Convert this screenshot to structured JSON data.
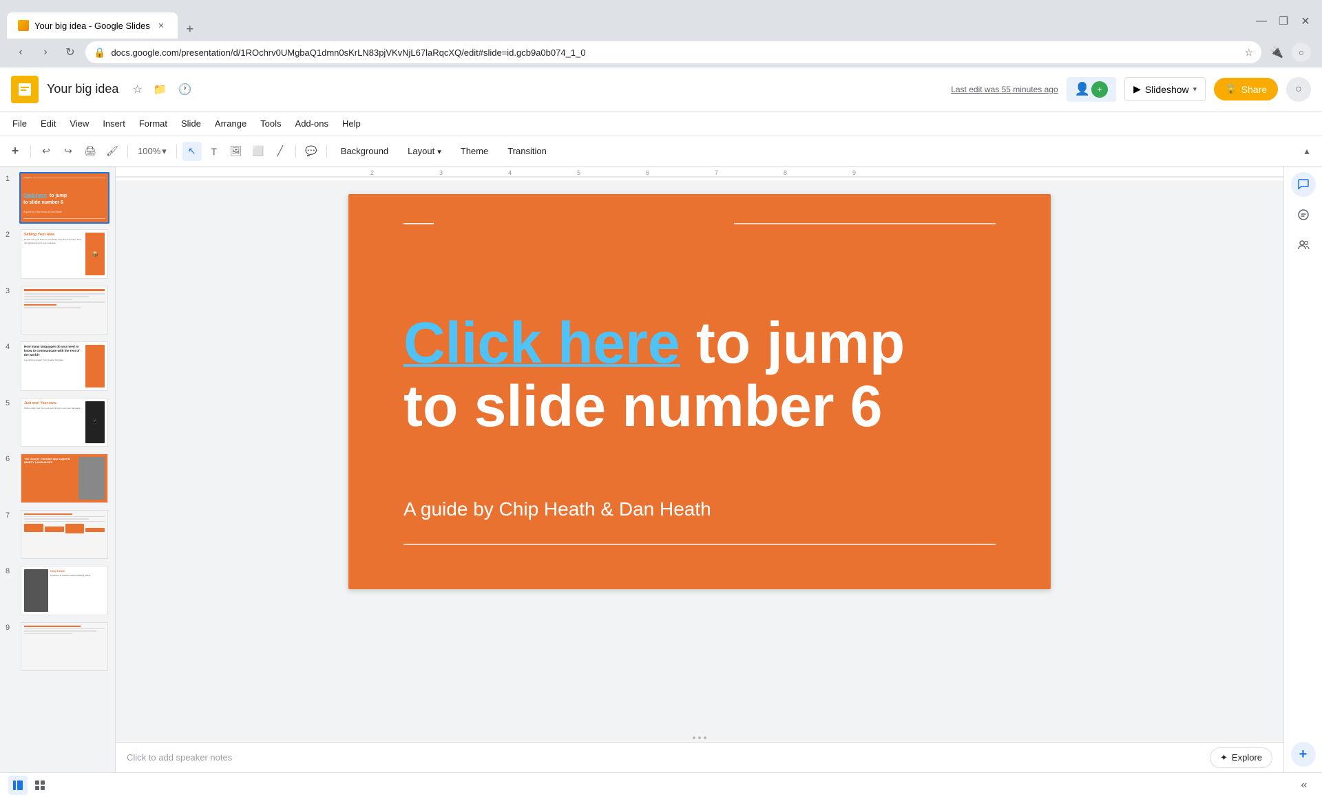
{
  "browser": {
    "tab_title": "Your big idea - Google Slides",
    "url": "docs.google.com/presentation/d/1ROchrv0UMgbaQ1dmn0sKrLN83pjVKvNjL67laRqcXQ/edit#slide=id.gcb9a0b074_1_0",
    "new_tab_label": "+",
    "favicon_alt": "Google Slides icon"
  },
  "header": {
    "app_name": "Your big idea",
    "star_icon": "★",
    "drive_icon": "📁",
    "history_icon": "🕐",
    "slideshow_label": "Slideshow",
    "slideshow_dropdown": "▾",
    "share_label": "Share",
    "share_icon": "🔒",
    "last_edit": "Last edit was 55 minutes ago",
    "collab_icon": "👥"
  },
  "menu": {
    "items": [
      "File",
      "Edit",
      "View",
      "Insert",
      "Format",
      "Slide",
      "Arrange",
      "Tools",
      "Add-ons",
      "Help"
    ]
  },
  "toolbar": {
    "add_icon": "+",
    "undo_icon": "↩",
    "redo_icon": "↪",
    "print_icon": "🖨",
    "paint_icon": "🖌",
    "zoom_value": "100%",
    "select_icon": "↖",
    "text_icon": "T",
    "image_icon": "🖼",
    "shape_icon": "⬜",
    "line_icon": "╱",
    "comment_icon": "💬",
    "background_label": "Background",
    "layout_label": "Layout",
    "layout_arrow": "▾",
    "theme_label": "Theme",
    "transition_label": "Transition"
  },
  "slides": [
    {
      "num": "1",
      "active": true,
      "bg": "#e97230",
      "lines": [
        "Click here to jump",
        "to slide number 6"
      ],
      "sub": "A guide by Chip Heath & Dan Heath"
    },
    {
      "num": "2",
      "active": false,
      "title": "Selling Your Idea",
      "bg": "#fff"
    },
    {
      "num": "3",
      "active": false,
      "bg": "#f5f5f5"
    },
    {
      "num": "4",
      "active": false,
      "title": "How many languages do you need to know to communicate with the rest of the world?",
      "bg": "#fff"
    },
    {
      "num": "5",
      "active": false,
      "title": "Just one! Your own.",
      "bg": "#fff"
    },
    {
      "num": "6",
      "active": false,
      "title": "The Google Translate app",
      "bg": "#e97230"
    },
    {
      "num": "7",
      "active": false,
      "bg": "#f5f5f5"
    },
    {
      "num": "8",
      "active": false,
      "bg": "#fff"
    },
    {
      "num": "9",
      "active": false,
      "bg": "#f5f5f5"
    }
  ],
  "canvas": {
    "main_text_line1_link": "Click here",
    "main_text_line1_rest": " to jump",
    "main_text_line2": "to slide number 6",
    "subtitle": "A guide by Chip Heath & Dan Heath",
    "notes_placeholder": "Click to add speaker notes"
  },
  "bottom": {
    "explore_label": "Explore",
    "explore_icon": "✦",
    "view_grid_icon": "⊞",
    "view_filmstrip_icon": "≡",
    "collapse_icon": "«"
  },
  "right_panel": {
    "comment_icon": "💬",
    "chat_icon": "🗨",
    "collab_icon": "👥",
    "add_icon": "+"
  }
}
